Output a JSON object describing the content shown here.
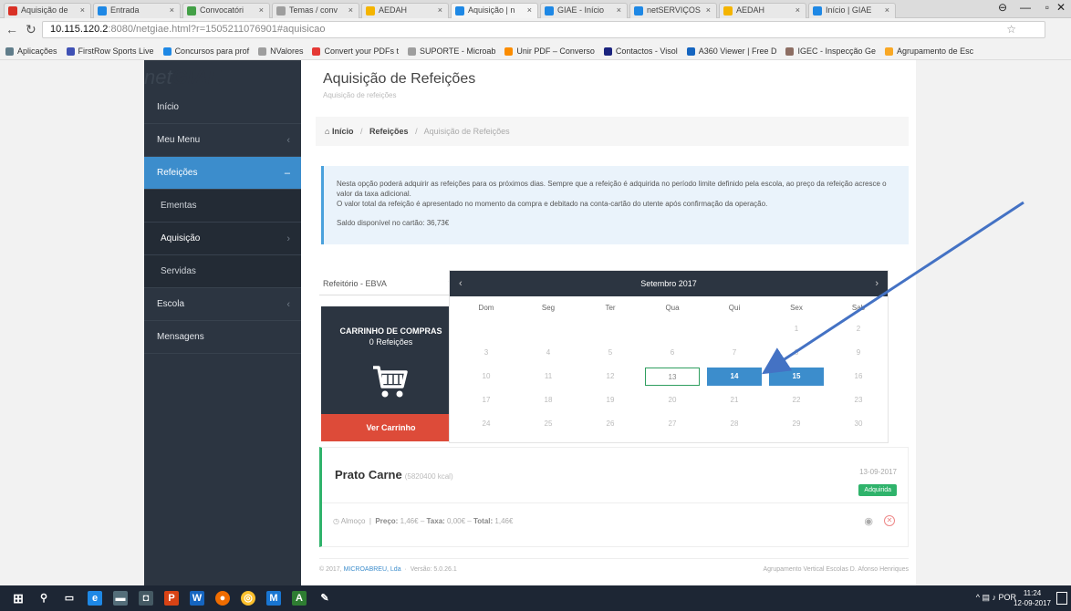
{
  "browser": {
    "tabs": [
      {
        "label": "Aquisição de",
        "color": "#d93025"
      },
      {
        "label": "Entrada",
        "color": "#1e88e5"
      },
      {
        "label": "Convocatóri",
        "color": "#43a047"
      },
      {
        "label": "Temas / conv",
        "color": "#9e9e9e"
      },
      {
        "label": "AEDAH",
        "color": "#f4b400"
      },
      {
        "label": "Aquisição | n",
        "color": "#1e88e5"
      },
      {
        "label": "GIAE - Início",
        "color": "#1e88e5"
      },
      {
        "label": "netSERVIÇOS",
        "color": "#1e88e5"
      },
      {
        "label": "AEDAH",
        "color": "#f4b400"
      },
      {
        "label": "Início | GIAE",
        "color": "#1e88e5"
      }
    ],
    "url_host": "10.115.120.2",
    "url_port": ":8080",
    "url_path": "/netgiae.html?r=1505211076901#aquisicao",
    "bookmarks": [
      {
        "label": "Aplicações",
        "color": "#607d8b"
      },
      {
        "label": "FirstRow Sports Live",
        "color": "#3f51b5"
      },
      {
        "label": "Concursos para prof",
        "color": "#1e88e5"
      },
      {
        "label": "NValores",
        "color": "#9e9e9e"
      },
      {
        "label": "Convert your PDFs t",
        "color": "#e53935"
      },
      {
        "label": "SUPORTE - Microab",
        "color": "#9e9e9e"
      },
      {
        "label": "Unir PDF – Converso",
        "color": "#fb8c00"
      },
      {
        "label": "Contactos - Visol",
        "color": "#1a237e"
      },
      {
        "label": "A360 Viewer | Free D",
        "color": "#1565c0"
      },
      {
        "label": "IGEC - Inspecção Ge",
        "color": "#8d6e63"
      },
      {
        "label": "Agrupamento de Esc",
        "color": "#f9a825"
      }
    ]
  },
  "app": {
    "logo_light": "net",
    "logo_bold": "GIAE",
    "sidebar": [
      {
        "label": "Início",
        "chevron": ""
      },
      {
        "label": "Meu Menu",
        "chevron": "‹"
      },
      {
        "label": "Refeições",
        "chevron": "–"
      },
      {
        "label": "Ementas",
        "chevron": ""
      },
      {
        "label": "Aquisição",
        "chevron": "›"
      },
      {
        "label": "Servidas",
        "chevron": ""
      },
      {
        "label": "Escola",
        "chevron": "‹"
      },
      {
        "label": "Mensagens",
        "chevron": ""
      }
    ]
  },
  "main": {
    "title": "Aquisição de Refeições",
    "subtitle": "Aquisição de refeições",
    "breadcrumb": {
      "home": "Início",
      "section": "Refeições",
      "current": "Aquisição de Refeições"
    },
    "info": {
      "line1": "Nesta opção poderá adquirir as refeições para os próximos dias. Sempre que a refeição é adquirida no período limite definido pela escola, ao preço da refeição acresce o valor da taxa adicional.",
      "line2": "O valor total da refeição é apresentado no momento da compra e debitado na conta-cartão do utente após confirmação da operação.",
      "balance": "Saldo disponível no cartão: 36,73€"
    },
    "refectory": "Refeitório - EBVA",
    "cart": {
      "title": "CARRINHO DE COMPRAS",
      "count": "0 Refeições",
      "button": "Ver Carrinho"
    },
    "calendar": {
      "month": "Setembro 2017",
      "dow": [
        "Dom",
        "Seg",
        "Ter",
        "Qua",
        "Qui",
        "Sex",
        "Sab"
      ],
      "weeks": [
        [
          "",
          "",
          "",
          "",
          "",
          "1",
          "2"
        ],
        [
          "3",
          "4",
          "5",
          "6",
          "7",
          "8",
          "9"
        ],
        [
          "10",
          "11",
          "12",
          "13",
          "14",
          "15",
          "16"
        ],
        [
          "17",
          "18",
          "19",
          "20",
          "21",
          "22",
          "23"
        ],
        [
          "24",
          "25",
          "26",
          "27",
          "28",
          "29",
          "30"
        ]
      ],
      "today": "13",
      "selected": [
        "14",
        "15"
      ]
    },
    "meal": {
      "title": "Prato Carne",
      "kcal": "(5820400 kcal)",
      "date": "13-09-2017",
      "badge": "Adquirida",
      "period": "Almoço",
      "price_label": "Preço:",
      "price": "1,46€",
      "tax_label": "Taxa:",
      "tax": "0,00€",
      "total_label": "Total:",
      "total": "1,46€"
    },
    "footer": {
      "copyright": "© 2017,",
      "company": "MICROABREU, Lda",
      "version": "Versão: 5.0.26.1",
      "school": "Agrupamento Vertical Escolas D. Afonso Henriques"
    }
  },
  "taskbar": {
    "lang": "POR",
    "time": "11:24",
    "date": "12-09-2017"
  }
}
